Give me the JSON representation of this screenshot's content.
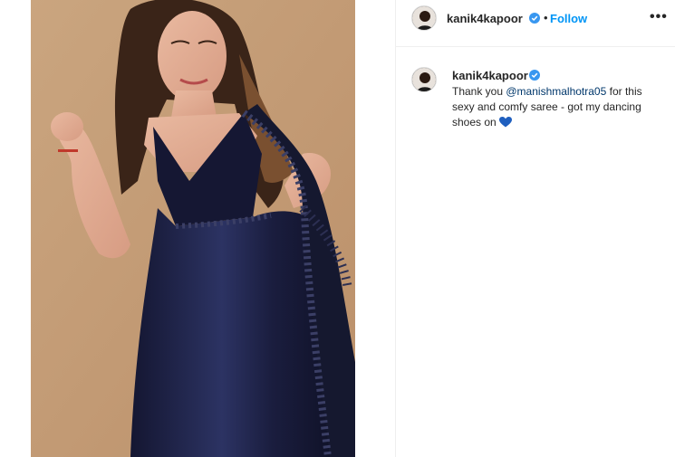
{
  "post": {
    "author": {
      "username": "kanik4kapoor",
      "verified": true,
      "separator": "•",
      "follow_label": "Follow"
    },
    "more_label": "•••",
    "caption": {
      "username": "kanik4kapoor",
      "text_before": "Thank you ",
      "mention": "@manishmalhotra05",
      "text_after": " for this sexy and comfy saree - got my dancing shoes on ",
      "emoji": "blue-heart"
    }
  },
  "colors": {
    "link": "#0095f6",
    "mention": "#00376b",
    "verified": "#3897f0",
    "heart": "#1f5fbf",
    "photo_background": "#c49b74",
    "saree": "#1c1f3d"
  },
  "icons": [
    "verified-badge-icon",
    "more-options-icon",
    "blue-heart-icon",
    "avatar"
  ]
}
